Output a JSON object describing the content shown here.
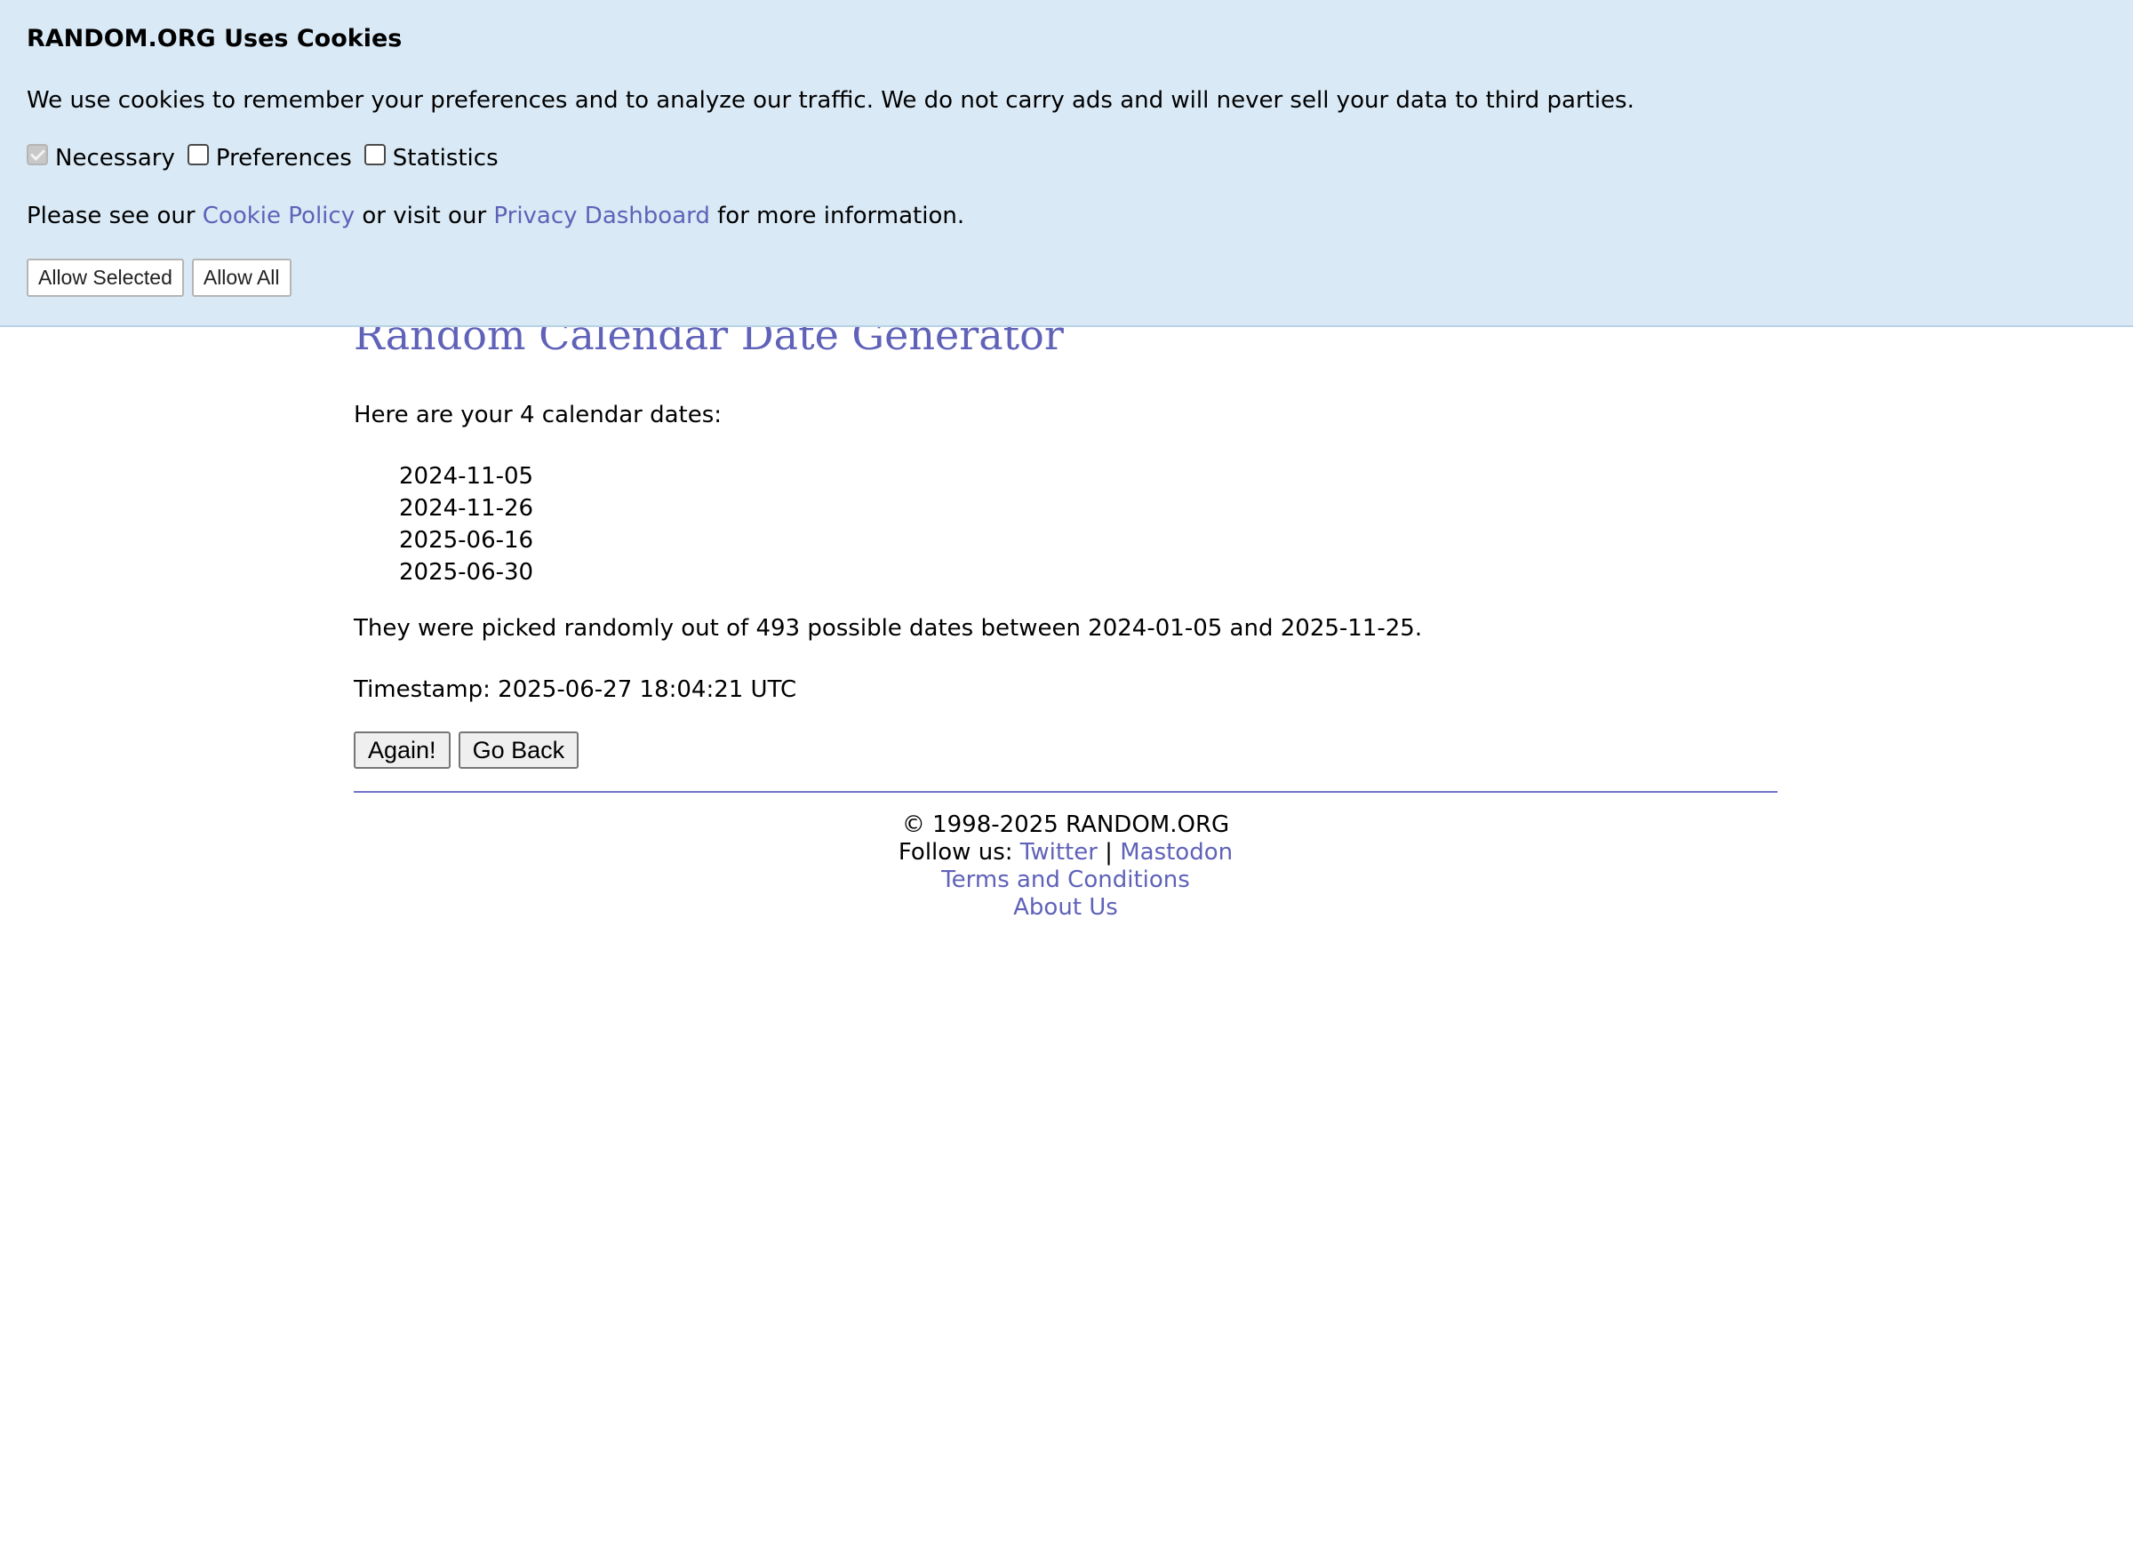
{
  "cookie_banner": {
    "title": "RANDOM.ORG Uses Cookies",
    "description": "We use cookies to remember your preferences and to analyze our traffic. We do not carry ads and will never sell your data to third parties.",
    "options": [
      {
        "label": "Necessary",
        "checked": true,
        "disabled": true
      },
      {
        "label": "Preferences",
        "checked": false,
        "disabled": false
      },
      {
        "label": "Statistics",
        "checked": false,
        "disabled": false
      }
    ],
    "policy_prefix": "Please see our ",
    "cookie_policy_link": "Cookie Policy",
    "policy_middle": " or visit our ",
    "privacy_dashboard_link": "Privacy Dashboard",
    "policy_suffix": " for more information.",
    "allow_selected_label": "Allow Selected",
    "allow_all_label": "Allow All"
  },
  "main": {
    "title": "Random Calendar Date Generator",
    "intro": "Here are your 4 calendar dates:",
    "dates": [
      "2024-11-05",
      "2024-11-26",
      "2025-06-16",
      "2025-06-30"
    ],
    "summary": "They were picked randomly out of 493 possible dates between 2024-01-05 and 2025-11-25.",
    "timestamp": "Timestamp: 2025-06-27 18:04:21 UTC",
    "again_label": "Again!",
    "go_back_label": "Go Back"
  },
  "footer": {
    "copyright": "© 1998-2025 RANDOM.ORG",
    "follow_prefix": "Follow us: ",
    "twitter_link": "Twitter",
    "separator": " | ",
    "mastodon_link": "Mastodon",
    "terms_link": "Terms and Conditions",
    "about_link": "About Us"
  },
  "colors": {
    "banner_background": "#d9e9f5",
    "link": "#5f62b8",
    "divider": "#7073c9"
  }
}
